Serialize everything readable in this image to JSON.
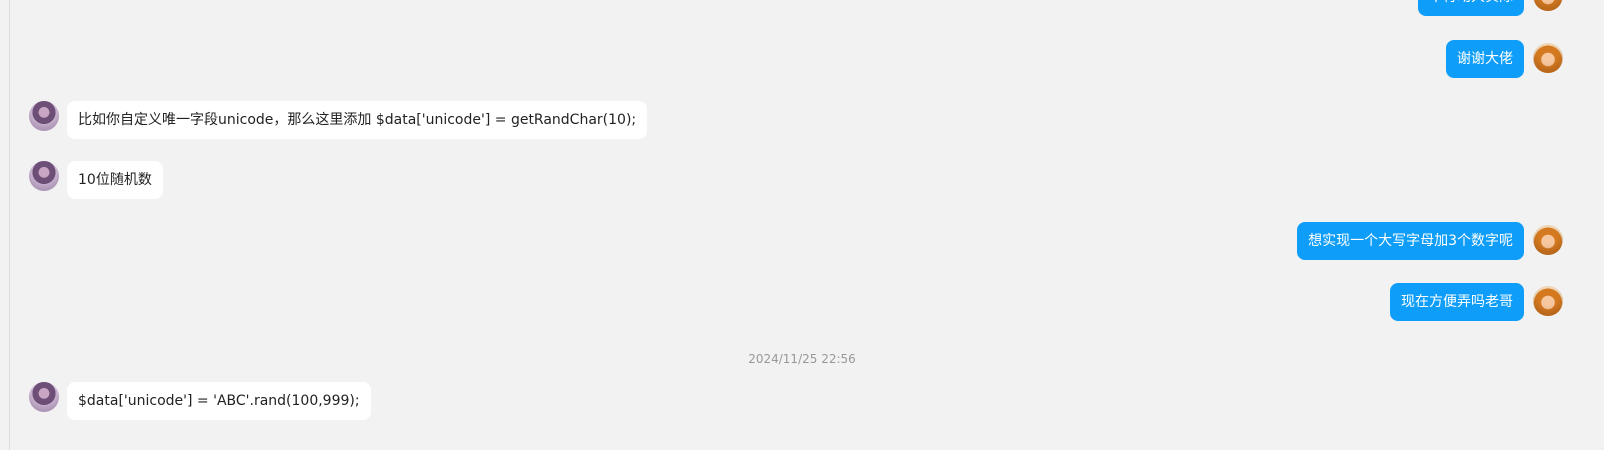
{
  "messages": [
    {
      "side": "right",
      "text": "不行动大实际"
    },
    {
      "side": "right",
      "text": "谢谢大佬"
    },
    {
      "side": "left",
      "text": "比如你自定义唯一字段unicode，那么这里添加  $data['unicode'] = getRandChar(10);"
    },
    {
      "side": "left",
      "text": "10位随机数"
    },
    {
      "side": "right",
      "text": "想实现一个大写字母加3个数字呢"
    },
    {
      "side": "right",
      "text": "现在方便弄吗老哥"
    },
    {
      "side": "left",
      "text": "$data['unicode'] = 'ABC'.rand(100,999);"
    }
  ],
  "timestamp": "2024/11/25 22:56"
}
